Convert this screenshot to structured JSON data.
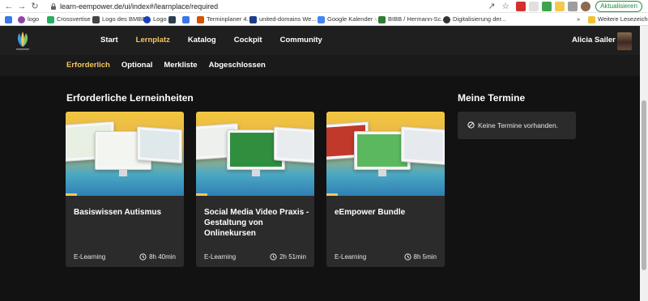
{
  "browser": {
    "url": "learn-eempower.de/ui/index#/learnplace/required",
    "update_label": "Aktualisieren"
  },
  "bookmarks": [
    {
      "label": "",
      "color": "#3b78e7"
    },
    {
      "label": "logo",
      "color": "#8e44ad"
    },
    {
      "label": "Crossvertise",
      "color": "#27ae60"
    },
    {
      "label": "Logo des BMBF",
      "color": "#444444"
    },
    {
      "label": "Logo",
      "color": "#1a3fb8"
    },
    {
      "label": "",
      "color": "#2c3e50"
    },
    {
      "label": "",
      "color": "#3b78e7"
    },
    {
      "label": "Terminplaner 4.1",
      "color": "#d35400"
    },
    {
      "label": "united-domains We...",
      "color": "#1e3c8c"
    },
    {
      "label": "Google Kalender -...",
      "color": "#4285f4"
    },
    {
      "label": "BIBB / Hermann-Sc...",
      "color": "#2e7d32"
    },
    {
      "label": "Digitalisierung der...",
      "color": "#333333"
    },
    {
      "label": "Weitere Lesezeichen",
      "color": "#f1c232"
    }
  ],
  "header": {
    "nav": [
      {
        "label": "Start",
        "active": false
      },
      {
        "label": "Lernplatz",
        "active": true
      },
      {
        "label": "Katalog",
        "active": false
      },
      {
        "label": "Cockpit",
        "active": false
      },
      {
        "label": "Community",
        "active": false
      }
    ],
    "user_name": "Alicia Sailer"
  },
  "subnav": [
    {
      "label": "Erforderlich",
      "active": true
    },
    {
      "label": "Optional",
      "active": false
    },
    {
      "label": "Merkliste",
      "active": false
    },
    {
      "label": "Abgeschlossen",
      "active": false
    }
  ],
  "main": {
    "section_title": "Erforderliche Lerneinheiten",
    "cards": [
      {
        "title": "Basiswissen Autismus",
        "type": "E-Learning",
        "duration": "8h 40min",
        "screen_color": "#e8efe3"
      },
      {
        "title": "Social Media Video Praxis - Gestaltung von Onlinekursen",
        "type": "E-Learning",
        "duration": "2h 51min",
        "screen_color": "#2f8f3f"
      },
      {
        "title": "eEmpower Bundle",
        "type": "E-Learning",
        "duration": "8h 5min",
        "screen_color": "#5bb85f"
      }
    ]
  },
  "termine": {
    "title": "Meine Termine",
    "empty_text": "Keine Termine vorhanden."
  },
  "colors": {
    "accent": "#f3c75f",
    "background": "#121212",
    "card": "#2b2b2b"
  }
}
